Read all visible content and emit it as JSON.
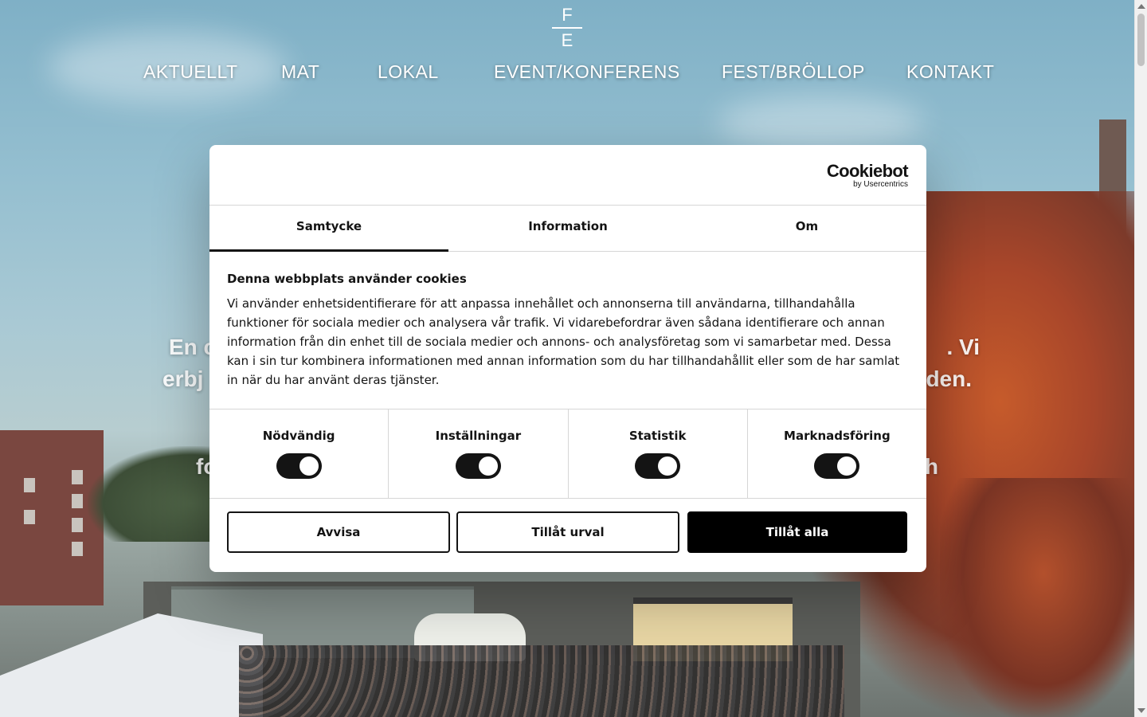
{
  "logo": {
    "top": "F",
    "bottom": "E"
  },
  "nav": {
    "items": [
      {
        "label": "AKTUELLT"
      },
      {
        "label": "MAT"
      },
      {
        "label": "LOKAL"
      },
      {
        "label": "EVENT/KONFERENS"
      },
      {
        "label": "FEST/BRÖLLOP"
      },
      {
        "label": "KONTAKT"
      }
    ]
  },
  "hero": {
    "line1_left": "En c",
    "line1_right": ". Vi",
    "line2_left": "erbj",
    "line2_right": "den.",
    "line3_left": "fo",
    "line3_right": "h"
  },
  "cookie_dialog": {
    "brand": "Cookiebot",
    "brand_sub": "by Usercentrics",
    "tabs": [
      {
        "label": "Samtycke",
        "active": true
      },
      {
        "label": "Information",
        "active": false
      },
      {
        "label": "Om",
        "active": false
      }
    ],
    "heading": "Denna webbplats använder cookies",
    "body": "Vi använder enhetsidentifierare för att anpassa innehållet och annonserna till användarna, tillhandahålla funktioner för sociala medier och analysera vår trafik. Vi vidarebefordrar även sådana identifierare och annan information från din enhet till de sociala medier och annons- och analysföretag som vi samarbetar med. Dessa kan i sin tur kombinera informationen med annan information som du har tillhandahållit eller som de har samlat in när du har använt deras tjänster.",
    "categories": [
      {
        "label": "Nödvändig",
        "enabled": true
      },
      {
        "label": "Inställningar",
        "enabled": true
      },
      {
        "label": "Statistik",
        "enabled": true
      },
      {
        "label": "Marknadsföring",
        "enabled": true
      }
    ],
    "buttons": {
      "deny": "Avvisa",
      "allow_selection": "Tillåt urval",
      "allow_all": "Tillåt alla"
    }
  },
  "colors": {
    "dialog_text": "#141414",
    "primary_button": "#000000",
    "nav_text": "#ffffff"
  }
}
